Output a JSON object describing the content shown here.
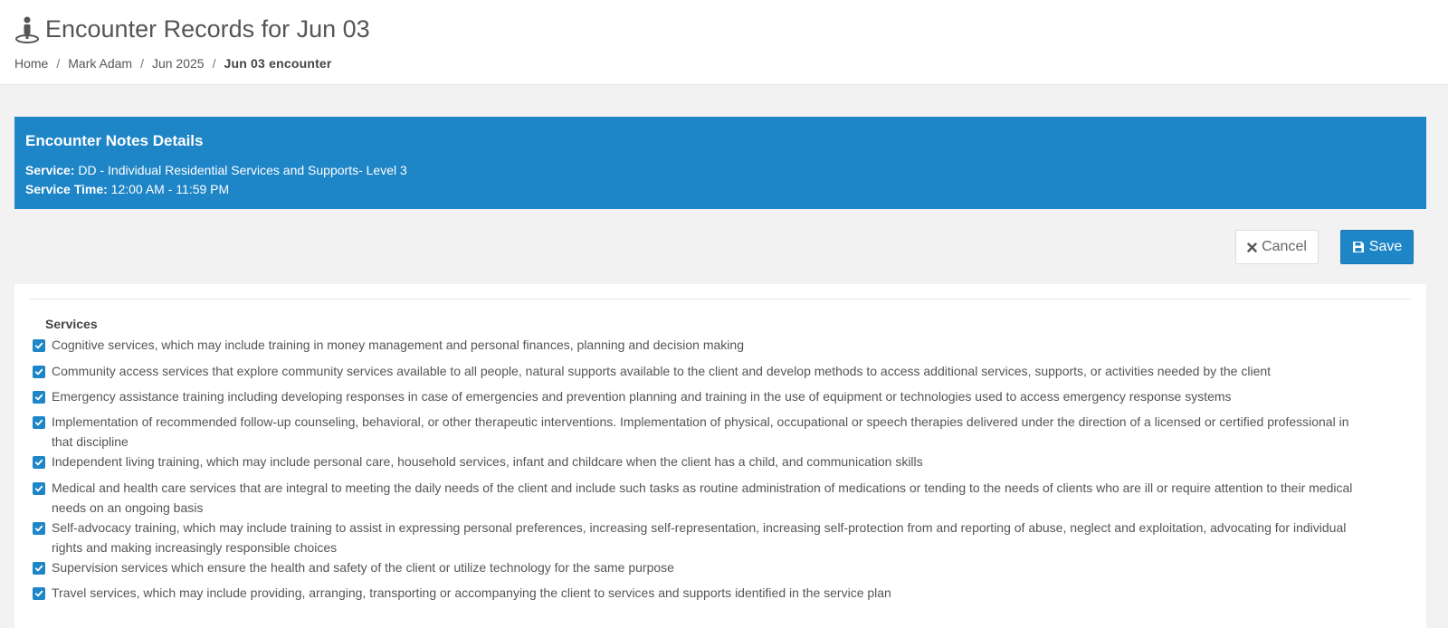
{
  "header": {
    "title": "Encounter Records for Jun 03",
    "breadcrumb": {
      "home": "Home",
      "client": "Mark Adam",
      "month": "Jun 2025",
      "current": "Jun 03 encounter",
      "separator": "/"
    }
  },
  "banner": {
    "title": "Encounter Notes Details",
    "service_label": "Service:",
    "service_value": " DD - Individual Residential Services and Supports- Level 3",
    "time_label": "Service Time:",
    "time_value": " 12:00 AM - 11:59 PM",
    "color": "#1e85c7"
  },
  "actions": {
    "cancel_label": "Cancel",
    "save_label": "Save"
  },
  "services": {
    "label": "Services",
    "items": [
      {
        "text": "Cognitive services, which may include training in money management and personal finances, planning and decision making",
        "checked": true
      },
      {
        "text": "Community access services that explore community services available to all people, natural supports available to the client and develop methods to access additional services, supports, or activities needed by the client",
        "checked": true
      },
      {
        "text": "Emergency assistance training including developing responses in case of emergencies and prevention planning and training in the use of equipment or technologies used to access emergency response systems",
        "checked": true
      },
      {
        "text": "Implementation of recommended follow-up counseling, behavioral, or other therapeutic interventions. Implementation of physical, occupational or speech therapies delivered under the direction of a licensed or certified professional in that discipline",
        "checked": true
      },
      {
        "text": "Independent living training, which may include personal care, household services, infant and childcare when the client has a child, and communication skills",
        "checked": true
      },
      {
        "text": "Medical and health care services that are integral to meeting the daily needs of the client and include such tasks as routine administration of medications or tending to the needs of clients who are ill or require attention to their medical needs on an ongoing basis",
        "checked": true
      },
      {
        "text": "Self-advocacy training, which may include training to assist in expressing personal preferences, increasing self-representation, increasing self-protection from and reporting of abuse, neglect and exploitation, advocating for individual rights and making increasingly responsible choices",
        "checked": true
      },
      {
        "text": "Supervision services which ensure the health and safety of the client or utilize technology for the same purpose",
        "checked": true
      },
      {
        "text": "Travel services, which may include providing, arranging, transporting or accompanying the client to services and supports identified in the service plan",
        "checked": true
      }
    ]
  }
}
